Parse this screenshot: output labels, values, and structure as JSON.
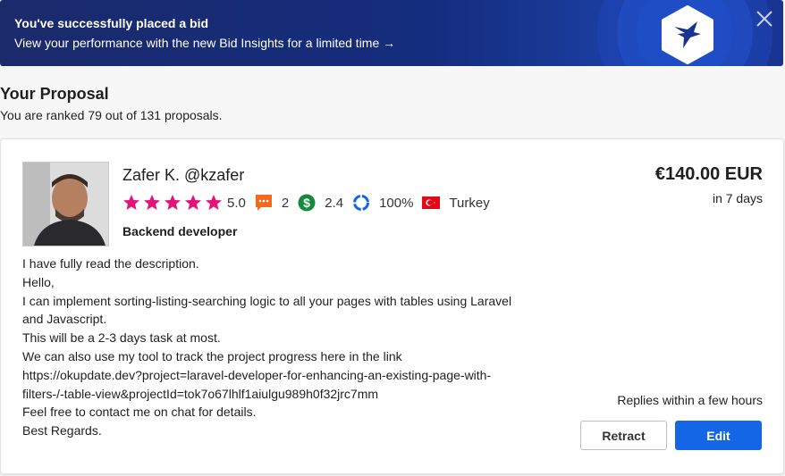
{
  "banner": {
    "title": "You've successfully placed a bid",
    "subtitle": "View your performance with the new Bid Insights for a limited time →",
    "logo_icon": "freelancer-bird-icon",
    "close_icon": "close-icon",
    "colors": {
      "background": "#152d7e",
      "text": "#ffffff"
    }
  },
  "proposal": {
    "heading": "Your Proposal",
    "rank_text": "You are ranked 79 out of 131 proposals."
  },
  "bid": {
    "name": "Zafer K. @kzafer",
    "rating": 5.0,
    "rating_text": "5.0",
    "reviews_count": "2",
    "earnings_score": "2.4",
    "completion_rate": "100%",
    "country": "Turkey",
    "role": "Backend developer",
    "description_lines": [
      "I have fully read the description.",
      "Hello,",
      "I can implement sorting-listing-searching logic to all your pages with tables using Laravel",
      "and Javascript.",
      "This will be a 2-3 days task at most.",
      "We can also use my tool to track the project progress here in the link",
      "https://okupdate.dev?project=laravel-developer-for-enhancing-an-existing-page-with-",
      "filters-/-table-view&projectId=tok7o67lhlf1aiulgu989h0f32jrc7mm",
      "Feel free to contact me on chat for details.",
      "Best Regards."
    ],
    "price": "€140.00 EUR",
    "duration": "in 7 days",
    "replies": "Replies within a few hours",
    "colors": {
      "star": "#e6127b",
      "reviews": "#f26b1d",
      "earnings": "#138a3c",
      "completion": "#1466e6",
      "flag": "#e30a17"
    }
  },
  "actions": {
    "retract_label": "Retract",
    "edit_label": "Edit",
    "edit_color": "#1466e6"
  }
}
